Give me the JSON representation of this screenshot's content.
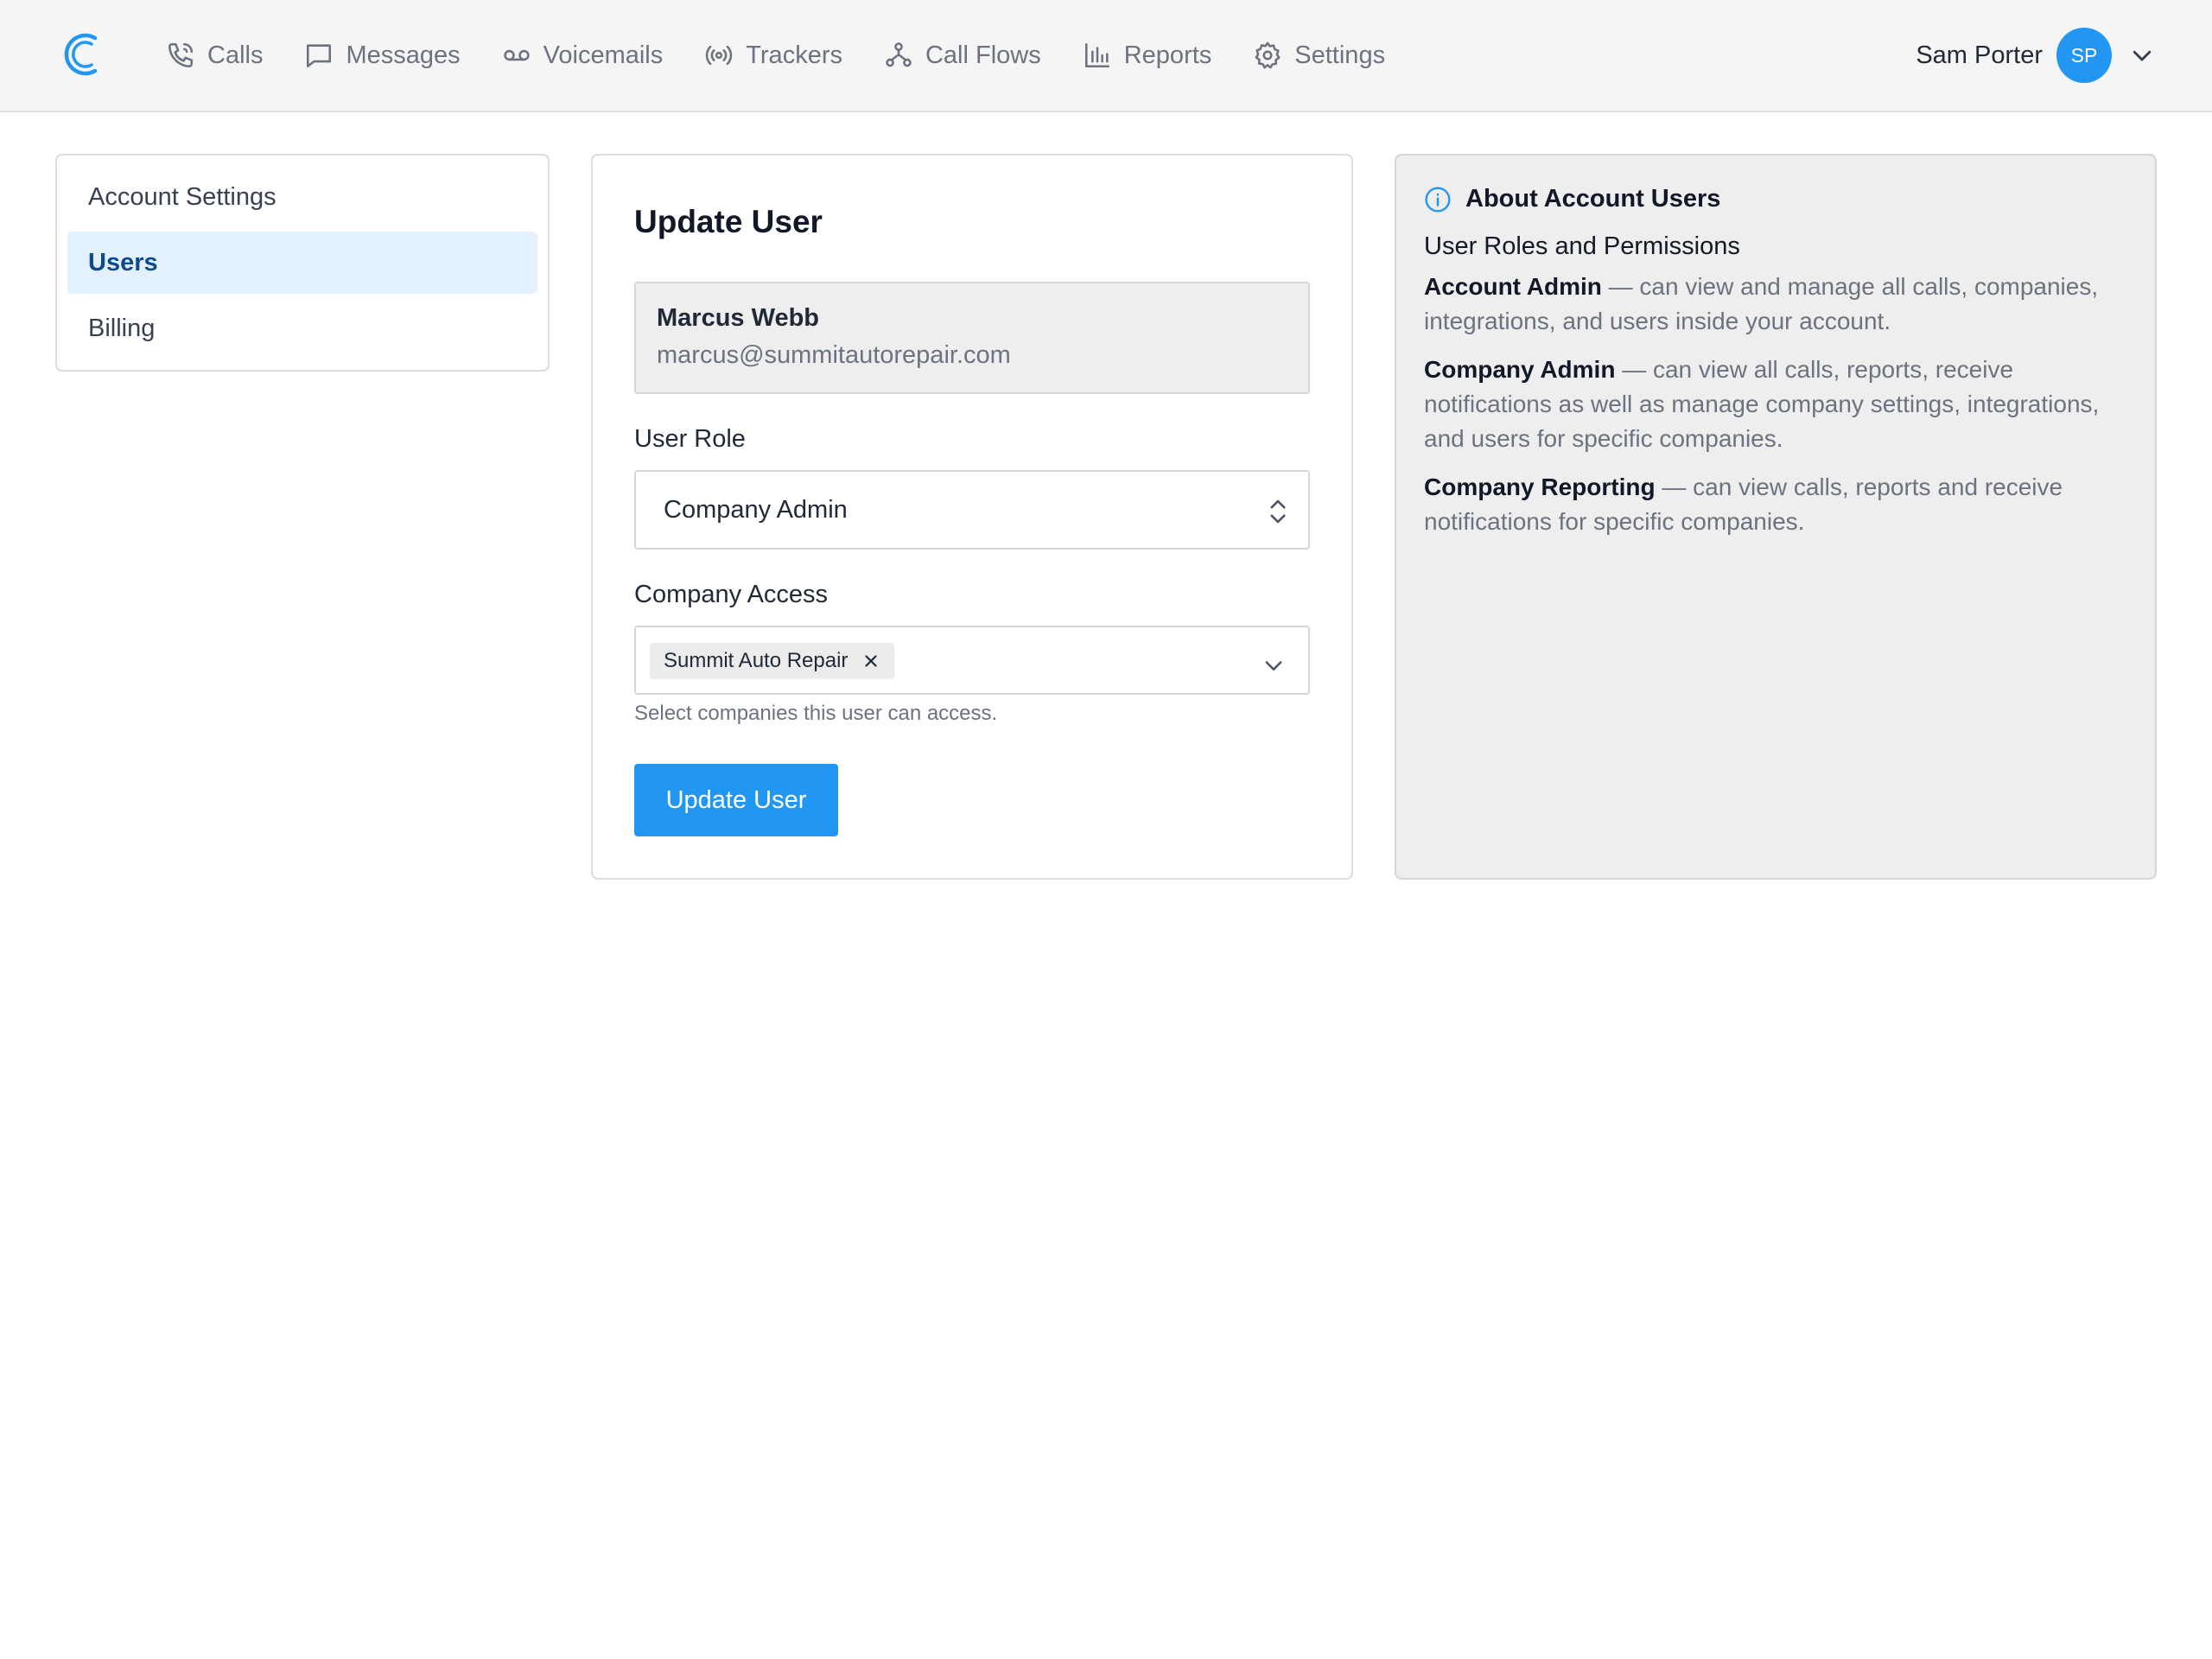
{
  "nav": {
    "items": [
      {
        "label": "Calls",
        "icon": "phone-icon"
      },
      {
        "label": "Messages",
        "icon": "message-icon"
      },
      {
        "label": "Voicemails",
        "icon": "voicemail-icon"
      },
      {
        "label": "Trackers",
        "icon": "broadcast-icon"
      },
      {
        "label": "Call Flows",
        "icon": "flow-icon"
      },
      {
        "label": "Reports",
        "icon": "bar-chart-icon"
      },
      {
        "label": "Settings",
        "icon": "gear-icon"
      }
    ],
    "user_name": "Sam Porter",
    "avatar_initials": "SP"
  },
  "sidebar": {
    "items": [
      {
        "label": "Account Settings"
      },
      {
        "label": "Users"
      },
      {
        "label": "Billing"
      }
    ]
  },
  "form": {
    "title": "Update User",
    "user": {
      "name": "Marcus Webb",
      "email": "marcus@summitautorepair.com"
    },
    "role_label": "User Role",
    "role_value": "Company Admin",
    "access_label": "Company Access",
    "access_chip": "Summit Auto Repair",
    "access_help": "Select companies this user can access.",
    "submit_label": "Update User"
  },
  "info": {
    "title": "About Account Users",
    "subtitle": "User Roles and Permissions",
    "roles": [
      {
        "name": "Account Admin",
        "desc": " — can view and manage all calls, companies, integrations, and users inside your account."
      },
      {
        "name": "Company Admin",
        "desc": " — can view all calls, reports, receive notifications as well as manage company settings, integrations, and users for specific companies."
      },
      {
        "name": "Company Reporting",
        "desc": " — can view calls, reports and receive notifications for specific companies."
      }
    ]
  },
  "colors": {
    "accent": "#2196f3",
    "active_bg": "#e3f0fd",
    "active_text": "#0b4a8f"
  }
}
